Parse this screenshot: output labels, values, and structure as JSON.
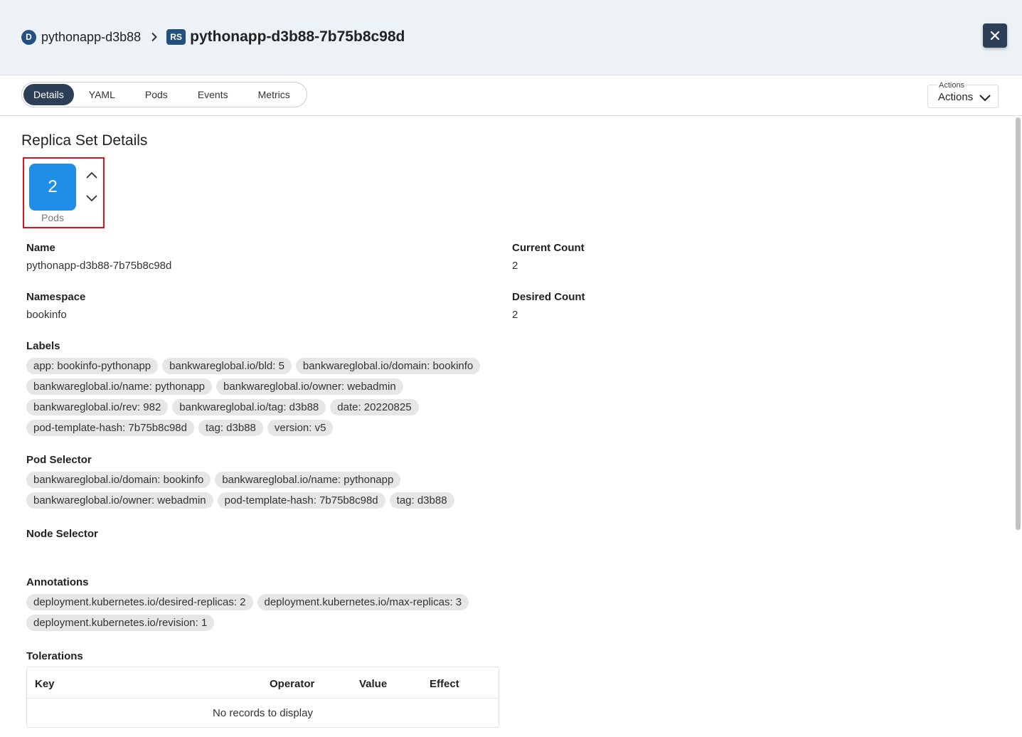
{
  "header": {
    "parent_badge": "D",
    "parent_name": "pythonapp-d3b88",
    "current_badge": "RS",
    "current_name": "pythonapp-d3b88-7b75b8c98d"
  },
  "tabs": [
    "Details",
    "YAML",
    "Pods",
    "Events",
    "Metrics"
  ],
  "active_tab": "Details",
  "actions": {
    "caption": "Actions",
    "value": "Actions"
  },
  "details": {
    "title": "Replica Set Details",
    "pod_count": "2",
    "pods_label": "Pods",
    "name_label": "Name",
    "name_value": "pythonapp-d3b88-7b75b8c98d",
    "namespace_label": "Namespace",
    "namespace_value": "bookinfo",
    "current_count_label": "Current Count",
    "current_count_value": "2",
    "desired_count_label": "Desired Count",
    "desired_count_value": "2",
    "labels_label": "Labels",
    "labels": [
      "app: bookinfo-pythonapp",
      "bankwareglobal.io/bld: 5",
      "bankwareglobal.io/domain: bookinfo",
      "bankwareglobal.io/name: pythonapp",
      "bankwareglobal.io/owner: webadmin",
      "bankwareglobal.io/rev: 982",
      "bankwareglobal.io/tag: d3b88",
      "date: 20220825",
      "pod-template-hash: 7b75b8c98d",
      "tag: d3b88",
      "version: v5"
    ],
    "pod_selector_label": "Pod Selector",
    "pod_selector": [
      "bankwareglobal.io/domain: bookinfo",
      "bankwareglobal.io/name: pythonapp",
      "bankwareglobal.io/owner: webadmin",
      "pod-template-hash: 7b75b8c98d",
      "tag: d3b88"
    ],
    "node_selector_label": "Node Selector",
    "annotations_label": "Annotations",
    "annotations": [
      "deployment.kubernetes.io/desired-replicas: 2",
      "deployment.kubernetes.io/max-replicas: 3",
      "deployment.kubernetes.io/revision: 1"
    ],
    "tolerations_label": "Tolerations",
    "tolerations_columns": [
      "Key",
      "Operator",
      "Value",
      "Effect"
    ],
    "tolerations_empty": "No records to display"
  },
  "colors": {
    "accent_dark": "#2d3e57",
    "badge_blue": "#23507f",
    "pod_blue": "#1e8ee6",
    "highlight_red": "#e0101a"
  },
  "icons": {
    "breadcrumb_separator": "chevron-right-icon",
    "close": "close-icon",
    "actions_dropdown": "chevron-down-icon",
    "scale_up": "chevron-up-icon",
    "scale_down": "chevron-down-icon"
  }
}
